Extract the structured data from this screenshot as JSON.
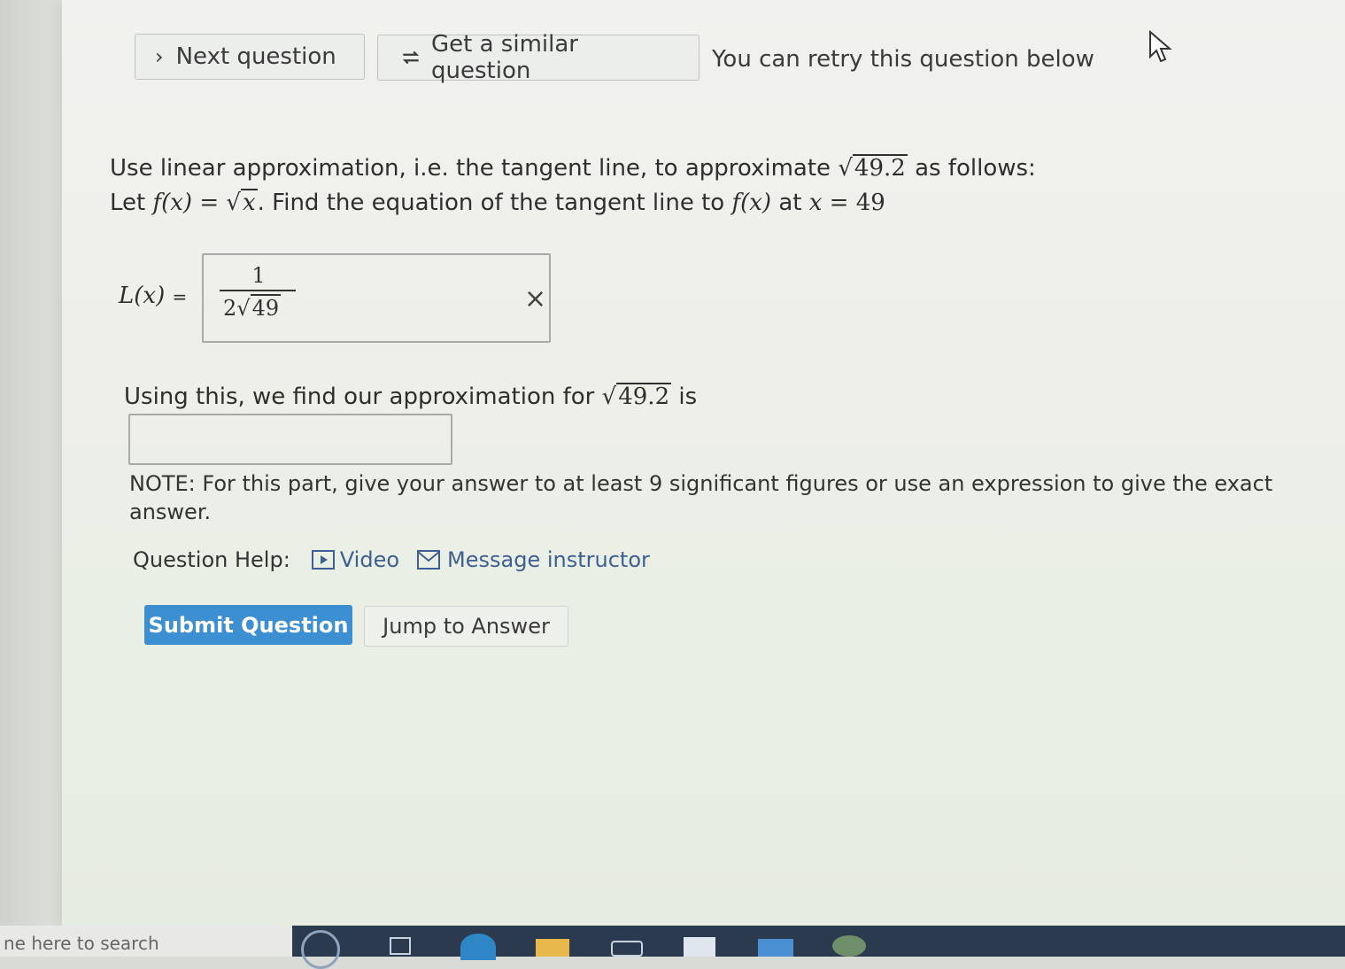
{
  "toolbar": {
    "next_label": "Next question",
    "similar_label": "Get a similar question",
    "retry_text": "You can retry this question below"
  },
  "question": {
    "line1_prefix": "Use linear approximation, i.e. the tangent line, to approximate",
    "line1_radicand": "49.2",
    "line1_suffix": "as follows:",
    "line2_let": "Let",
    "line2_fx": "f(x)",
    "line2_eq": "=",
    "line2_radicand": "x",
    "line2_mid": ". Find the equation of the tangent line to",
    "line2_fx2": "f(x)",
    "line2_at": "at",
    "line2_x": "x",
    "line2_eq2": "=",
    "line2_val": "49"
  },
  "part1": {
    "label": "L(x)",
    "eq": "=",
    "answer_numerator": "1",
    "answer_coef": "2",
    "answer_radicand": "49",
    "status_mark": "×"
  },
  "part2": {
    "prefix": "Using this, we find our approximation for",
    "radicand": "49.2",
    "suffix": "is",
    "input_value": "",
    "note": "NOTE: For this part, give your answer to at least 9 significant figures or use an expression to give the exact answer."
  },
  "help": {
    "label": "Question Help:",
    "video": "Video",
    "message": "Message instructor"
  },
  "actions": {
    "submit": "Submit Question",
    "jump": "Jump to Answer"
  },
  "taskbar": {
    "search_placeholder": "ne here to search"
  }
}
